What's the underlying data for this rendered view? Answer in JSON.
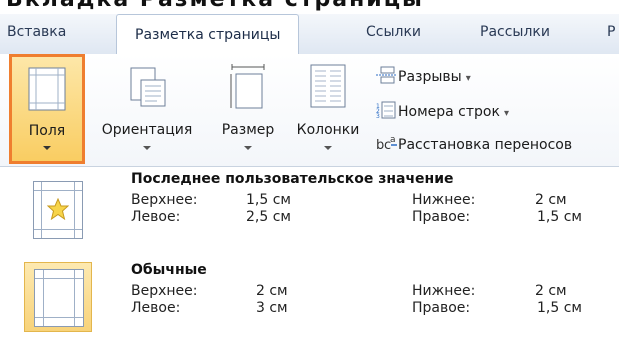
{
  "caption": {
    "text": "Вкладка Разметка страницы"
  },
  "tabs": [
    {
      "label": "Вставка"
    },
    {
      "label": "Разметка страницы"
    },
    {
      "label": "Ссылки"
    },
    {
      "label": "Рассылки"
    },
    {
      "label": "Р"
    }
  ],
  "ribbon": {
    "fields": {
      "label": "Поля",
      "icon": "margins-icon"
    },
    "orientation": {
      "label": "Ориентация",
      "icon": "orientation-icon"
    },
    "size": {
      "label": "Размер",
      "icon": "page-size-icon"
    },
    "columns": {
      "label": "Колонки",
      "icon": "columns-icon"
    },
    "breaks": {
      "label": "Разрывы",
      "icon": "breaks-icon"
    },
    "line_numbers": {
      "label": "Номера строк",
      "icon": "line-numbers-icon"
    },
    "hyphenation": {
      "label": "Расстановка переносов",
      "icon": "hyphenation-icon"
    }
  },
  "margins_menu": {
    "items": [
      {
        "title": "Последнее пользовательское значение",
        "icon": "custom-margins-star-icon",
        "top_label": "Верхнее:",
        "top_value": "1,5 см",
        "bottom_label": "Нижнее:",
        "bottom_value": "2 см",
        "left_label": "Левое:",
        "left_value": "2,5 см",
        "right_label": "Правое:",
        "right_value": "1,5 см"
      },
      {
        "title": "Обычные",
        "icon": "normal-margins-icon",
        "top_label": "Верхнее:",
        "top_value": "2 см",
        "bottom_label": "Нижнее:",
        "bottom_value": "2 см",
        "left_label": "Левое:",
        "left_value": "3 см",
        "right_label": "Правое:",
        "right_value": "1,5 см"
      }
    ]
  },
  "colors": {
    "highlight_border": "#ef7e2f",
    "highlight_fill": "#f9cd62"
  }
}
